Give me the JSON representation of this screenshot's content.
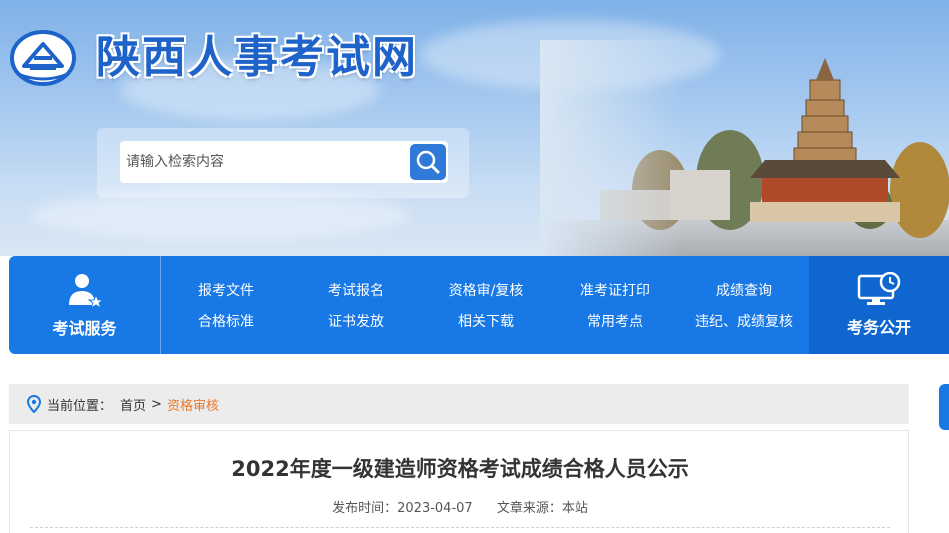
{
  "header": {
    "site_title": "陕西人事考试网",
    "search": {
      "placeholder": "请输入检索内容"
    }
  },
  "nav": {
    "service_label": "考试服务",
    "public_label": "考务公开",
    "links": [
      "报考文件",
      "考试报名",
      "资格审/复核",
      "准考证打印",
      "成绩查询",
      "合格标准",
      "证书发放",
      "相关下载",
      "常用考点",
      "违纪、成绩复核"
    ]
  },
  "breadcrumb": {
    "prefix": "当前位置：",
    "home": "首页",
    "separator": ">",
    "current": "资格审核"
  },
  "article": {
    "title": "2022年度一级建造师资格考试成绩合格人员公示",
    "publish_label": "发布时间：",
    "publish_date": "2023-04-07",
    "source_label": "文章来源：",
    "source": "本站"
  },
  "colors": {
    "brand_blue": "#1778e6",
    "title_blue": "#1e63c9",
    "accent_orange": "#e8782a"
  },
  "icons": [
    "logo-icon",
    "search-icon",
    "user-service-icon",
    "monitor-clock-icon",
    "location-pin-icon"
  ]
}
